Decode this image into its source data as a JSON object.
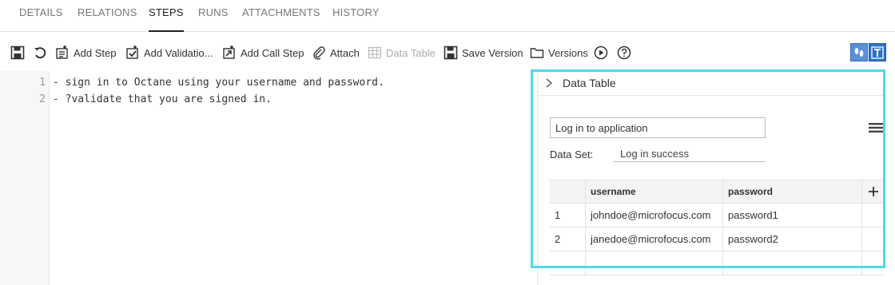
{
  "tabs": {
    "details": "DETAILS",
    "relations": "RELATIONS",
    "steps": "STEPS",
    "runs": "RUNS",
    "attachments": "ATTACHMENTS",
    "history": "HISTORY"
  },
  "toolbar": {
    "add_step": "Add Step",
    "add_validation": "Add Validatio...",
    "add_call_step": "Add Call Step",
    "attach": "Attach",
    "data_table": "Data Table",
    "save_version": "Save Version",
    "versions": "Versions"
  },
  "editor": {
    "lines": [
      {
        "num": "1",
        "text": "- sign in to Octane using your username and password."
      },
      {
        "num": "2",
        "text": "- ?validate that you are signed in."
      }
    ]
  },
  "data_table_panel": {
    "title": "Data Table",
    "table_name": "Log in to application",
    "data_set_label": "Data Set:",
    "data_set_value": "Log in success",
    "columns": [
      "",
      "username",
      "password"
    ],
    "rows": [
      {
        "index": "1",
        "username": "johndoe@microfocus.com",
        "password": "password1"
      },
      {
        "index": "2",
        "username": "janedoe@microfocus.com",
        "password": "password2"
      }
    ]
  },
  "colors": {
    "highlight": "#4dd9ee",
    "view_toggle": "#2d73c7"
  }
}
